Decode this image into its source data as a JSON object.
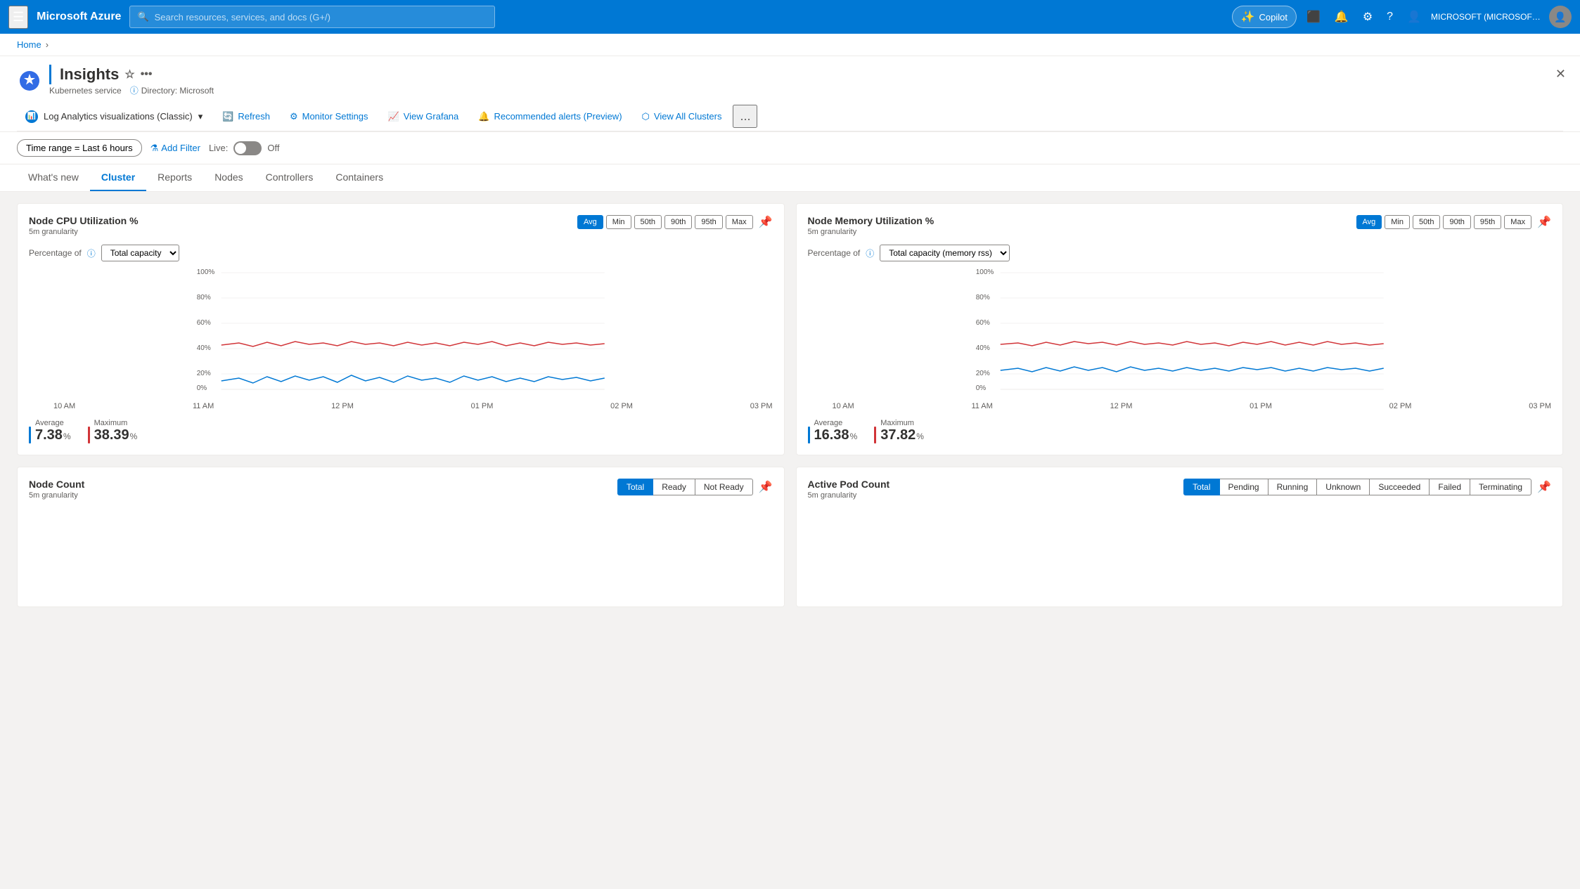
{
  "nav": {
    "hamburger_label": "☰",
    "logo": "Microsoft Azure",
    "search_placeholder": "Search resources, services, and docs (G+/)",
    "copilot_label": "Copilot",
    "user_text": "MICROSOFT (MICROSOFT.ONMI...",
    "icons": {
      "terminal": "⬜",
      "bell": "🔔",
      "gear": "⚙",
      "help": "?",
      "user": "👤"
    }
  },
  "breadcrumb": {
    "home": "Home",
    "chevron": "›"
  },
  "page": {
    "title": "Insights",
    "service": "Kubernetes service",
    "directory_label": "Directory: Microsoft",
    "close_label": "✕"
  },
  "toolbar": {
    "nav_item": "Log Analytics visualizations (Classic)",
    "refresh_label": "Refresh",
    "monitor_settings_label": "Monitor Settings",
    "view_grafana_label": "View Grafana",
    "recommended_alerts_label": "Recommended alerts (Preview)",
    "view_all_clusters_label": "View All Clusters",
    "more_label": "..."
  },
  "filter_bar": {
    "time_range_label": "Time range = Last 6 hours",
    "add_filter_label": "Add Filter",
    "live_label": "Live:",
    "off_label": "Off"
  },
  "tabs": [
    {
      "id": "whats-new",
      "label": "What's new"
    },
    {
      "id": "cluster",
      "label": "Cluster",
      "active": true
    },
    {
      "id": "reports",
      "label": "Reports"
    },
    {
      "id": "nodes",
      "label": "Nodes"
    },
    {
      "id": "controllers",
      "label": "Controllers"
    },
    {
      "id": "containers",
      "label": "Containers"
    }
  ],
  "cpu_chart": {
    "title": "Node CPU Utilization %",
    "granularity": "5m granularity",
    "stat_buttons": [
      "Avg",
      "Min",
      "50th",
      "90th",
      "95th",
      "Max"
    ],
    "active_stat": "Avg",
    "percentage_of_label": "Percentage of",
    "percentage_dropdown": "Total capacity",
    "y_labels": [
      "100%",
      "80%",
      "60%",
      "40%",
      "20%",
      "0%"
    ],
    "x_labels": [
      "10 AM",
      "11 AM",
      "12 PM",
      "01 PM",
      "02 PM",
      "03 PM"
    ],
    "avg_label": "Average",
    "avg_value": "7.38",
    "avg_unit": "%",
    "max_label": "Maximum",
    "max_value": "38.39",
    "max_unit": "%",
    "avg_color": "#0078d4",
    "max_color": "#d13438"
  },
  "memory_chart": {
    "title": "Node Memory Utilization %",
    "granularity": "5m granularity",
    "stat_buttons": [
      "Avg",
      "Min",
      "50th",
      "90th",
      "95th",
      "Max"
    ],
    "active_stat": "Avg",
    "percentage_of_label": "Percentage of",
    "percentage_dropdown": "Total capacity (memory rss)",
    "y_labels": [
      "100%",
      "80%",
      "60%",
      "40%",
      "20%",
      "0%"
    ],
    "x_labels": [
      "10 AM",
      "11 AM",
      "12 PM",
      "01 PM",
      "02 PM",
      "03 PM"
    ],
    "avg_label": "Average",
    "avg_value": "16.38",
    "avg_unit": "%",
    "max_label": "Maximum",
    "max_value": "37.82",
    "max_unit": "%",
    "avg_color": "#0078d4",
    "max_color": "#d13438"
  },
  "node_count": {
    "title": "Node Count",
    "granularity": "5m granularity",
    "tab_buttons": [
      "Total",
      "Ready",
      "Not Ready"
    ],
    "active_tab": "Total"
  },
  "pod_count": {
    "title": "Active Pod Count",
    "granularity": "5m granularity",
    "tab_buttons": [
      "Total",
      "Pending",
      "Running",
      "Unknown",
      "Succeeded",
      "Failed",
      "Terminating"
    ],
    "active_tab": "Total"
  }
}
